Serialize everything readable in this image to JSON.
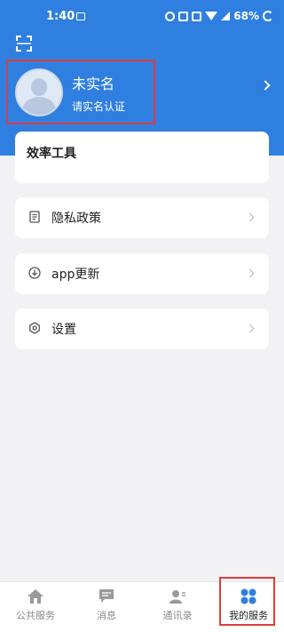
{
  "status_bar": {
    "time": "1:40",
    "battery": "68%"
  },
  "profile": {
    "name": "未实名",
    "subtitle": "请实名认证"
  },
  "tools": {
    "title": "效率工具"
  },
  "menu": [
    {
      "label": "隐私政策",
      "icon": "document-icon"
    },
    {
      "label": "app更新",
      "icon": "download-icon"
    },
    {
      "label": "设置",
      "icon": "settings-icon"
    }
  ],
  "tabs": [
    {
      "label": "公共服务",
      "icon": "home-icon"
    },
    {
      "label": "消息",
      "icon": "message-icon"
    },
    {
      "label": "通讯录",
      "icon": "contacts-icon"
    },
    {
      "label": "我的服务",
      "icon": "grid-icon",
      "active": true
    }
  ],
  "colors": {
    "brand_blue": "#2f7fe0",
    "highlight_red": "#e23b3b",
    "background": "#f2f2f4"
  }
}
